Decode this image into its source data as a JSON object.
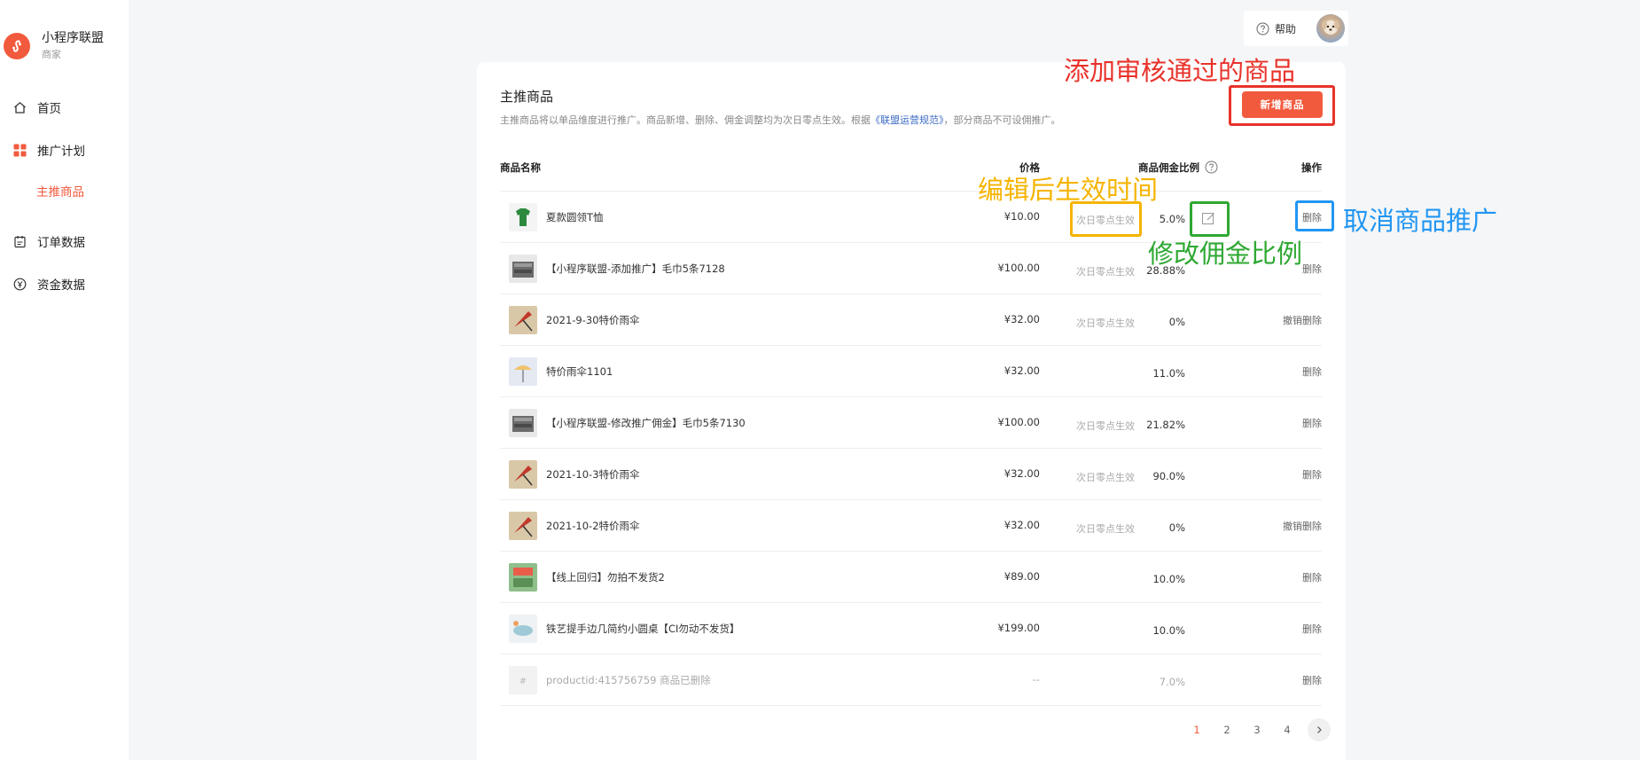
{
  "sidebar": {
    "brand_name": "小程序联盟",
    "brand_sub": "商家",
    "items": [
      {
        "label": "首页"
      },
      {
        "label": "推广计划"
      },
      {
        "label": "主推商品"
      },
      {
        "label": "订单数据"
      },
      {
        "label": "资金数据"
      }
    ]
  },
  "topbar": {
    "help_label": "帮助"
  },
  "main": {
    "title": "主推商品",
    "desc_before": "主推商品将以单品维度进行推广。商品新增、删除、佣金调整均为次日零点生效。根据",
    "desc_link": "《联盟运营规范》",
    "desc_after": "，部分商品不可设佣推广。",
    "add_button": "新增商品",
    "headers": {
      "name": "商品名称",
      "price": "价格",
      "ratio": "商品佣金比例",
      "op": "操作"
    },
    "rows": [
      {
        "name": "夏款圆领T恤",
        "price": "¥10.00",
        "status": "次日零点生效",
        "ratio": "5.0%",
        "op": "删除"
      },
      {
        "name": "【小程序联盟-添加推广】毛巾5条7128",
        "price": "¥100.00",
        "status": "次日零点生效",
        "ratio": "28.88%",
        "op": "删除"
      },
      {
        "name": "2021-9-30特价雨伞",
        "price": "¥32.00",
        "status": "次日零点生效",
        "ratio": "0%",
        "op": "撤销删除"
      },
      {
        "name": "特价雨伞1101",
        "price": "¥32.00",
        "status": "",
        "ratio": "11.0%",
        "op": "删除"
      },
      {
        "name": "【小程序联盟-修改推广佣金】毛巾5条7130",
        "price": "¥100.00",
        "status": "次日零点生效",
        "ratio": "21.82%",
        "op": "删除"
      },
      {
        "name": "2021-10-3特价雨伞",
        "price": "¥32.00",
        "status": "次日零点生效",
        "ratio": "90.0%",
        "op": "删除"
      },
      {
        "name": "2021-10-2特价雨伞",
        "price": "¥32.00",
        "status": "次日零点生效",
        "ratio": "0%",
        "op": "撤销删除"
      },
      {
        "name": "【线上回归】勿拍不发货2",
        "price": "¥89.00",
        "status": "",
        "ratio": "10.0%",
        "op": "删除"
      },
      {
        "name": "铁艺提手边几简约小圆桌【CI勿动不发货】",
        "price": "¥199.00",
        "status": "",
        "ratio": "10.0%",
        "op": "删除"
      },
      {
        "name": "productid:415756759 商品已删除",
        "price": "--",
        "status": "",
        "ratio": "7.0%",
        "op": "删除"
      }
    ],
    "pagination": [
      "1",
      "2",
      "3",
      "4"
    ]
  },
  "annotations": {
    "add": "添加审核通过的商品",
    "effective": "编辑后生效时间",
    "edit": "修改佣金比例",
    "cancel": "取消商品推广"
  },
  "colors": {
    "accent": "#f25a3d",
    "ann_red": "#e8322a",
    "ann_yellow": "#f5b400",
    "ann_green": "#2ea832",
    "ann_blue": "#2196f3"
  }
}
